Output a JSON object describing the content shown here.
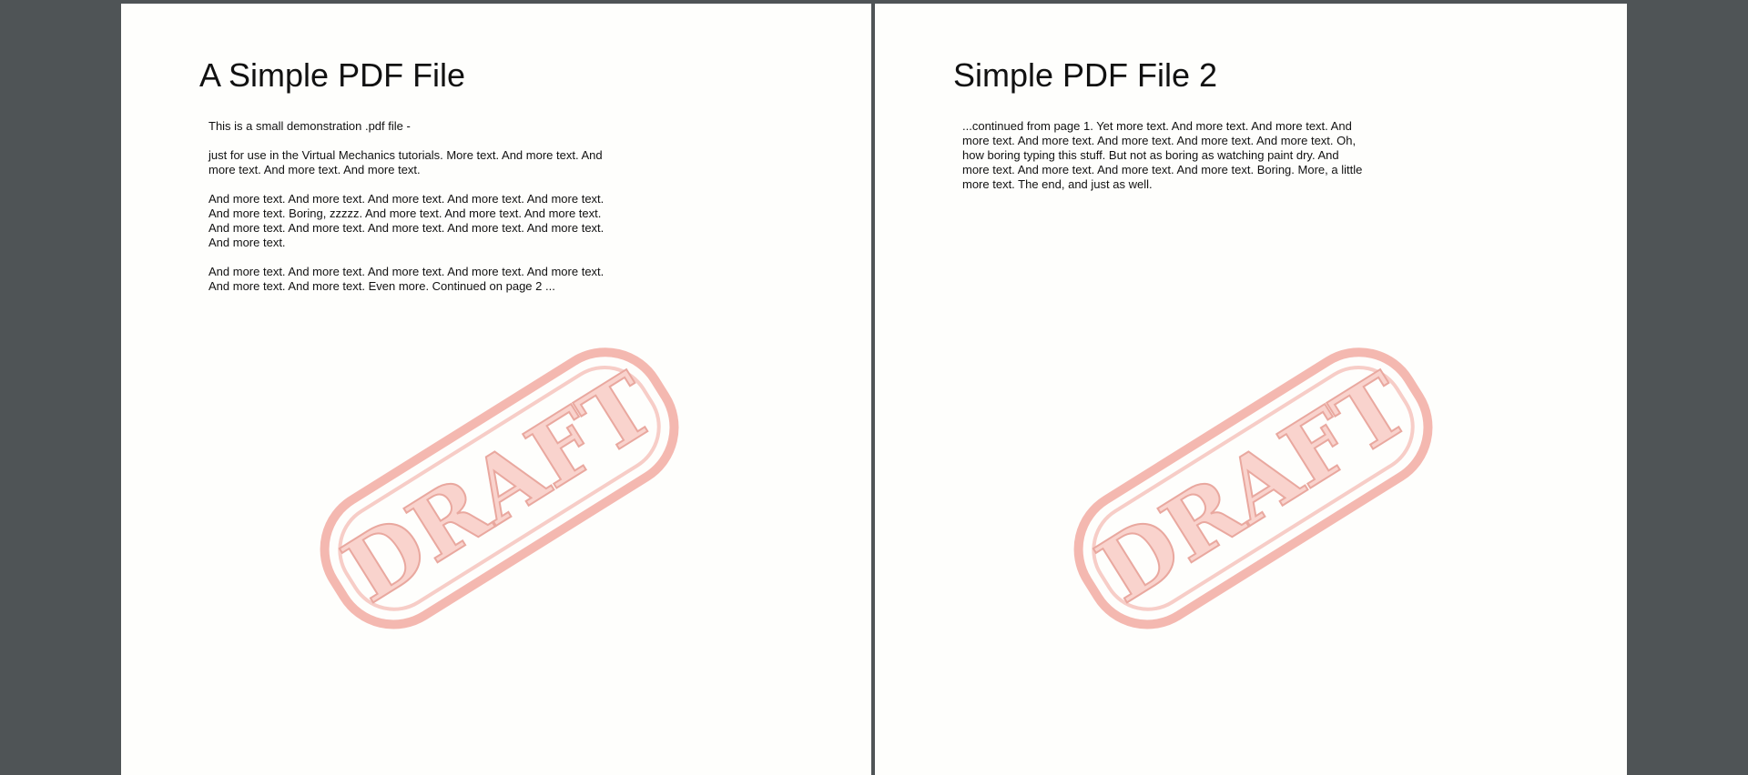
{
  "viewer": {
    "background_color": "#4f5456",
    "page_color": "#fefefc"
  },
  "pages": [
    {
      "title": "A Simple PDF File",
      "paragraphs": [
        "This is a small demonstration .pdf file -",
        "just for use in the Virtual Mechanics tutorials. More text. And more text. And more text. And more text. And more text.",
        "And more text. And more text. And more text. And more text. And more text. And more text. Boring, zzzzz. And more text. And more text. And more text. And more text. And more text. And more text. And more text. And more text. And more text.",
        "And more text. And more text. And more text. And more text. And more text. And more text. And more text. Even more. Continued on page 2 ..."
      ],
      "stamp": {
        "text": "DRAFT",
        "color": "#f4b8b0",
        "icon": "draft-stamp"
      }
    },
    {
      "title": "Simple PDF File 2",
      "paragraphs": [
        "...continued from page 1. Yet more text. And more text. And more text. And more text. And more text. And more text. And more text. And more text. Oh, how boring typing this stuff. But not as boring as watching paint dry. And more text. And more text. And more text. And more text. Boring.  More, a little more text. The end, and just as well."
      ],
      "stamp": {
        "text": "DRAFT",
        "color": "#f4b8b0",
        "icon": "draft-stamp"
      }
    }
  ]
}
